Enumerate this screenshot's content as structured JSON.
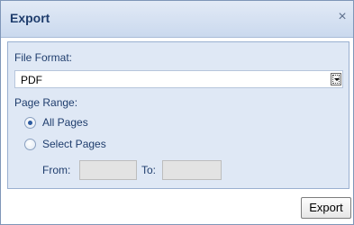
{
  "dialog": {
    "title": "Export",
    "close_symbol": "×"
  },
  "form": {
    "file_format_label": "File Format:",
    "file_format_value": "PDF",
    "page_range_label": "Page Range:",
    "options": [
      {
        "label": "All Pages",
        "selected": true
      },
      {
        "label": "Select Pages",
        "selected": false
      }
    ],
    "from_label": "From:",
    "to_label": "To:",
    "from_value": "",
    "to_value": ""
  },
  "footer": {
    "export_label": "Export"
  },
  "icons": {
    "close": "close-icon",
    "dropdown": "chevron-down-icon"
  },
  "colors": {
    "title_text": "#1f3d6d",
    "panel_background": "#dfe8f5",
    "titlebar_background": "#cad9ee"
  }
}
